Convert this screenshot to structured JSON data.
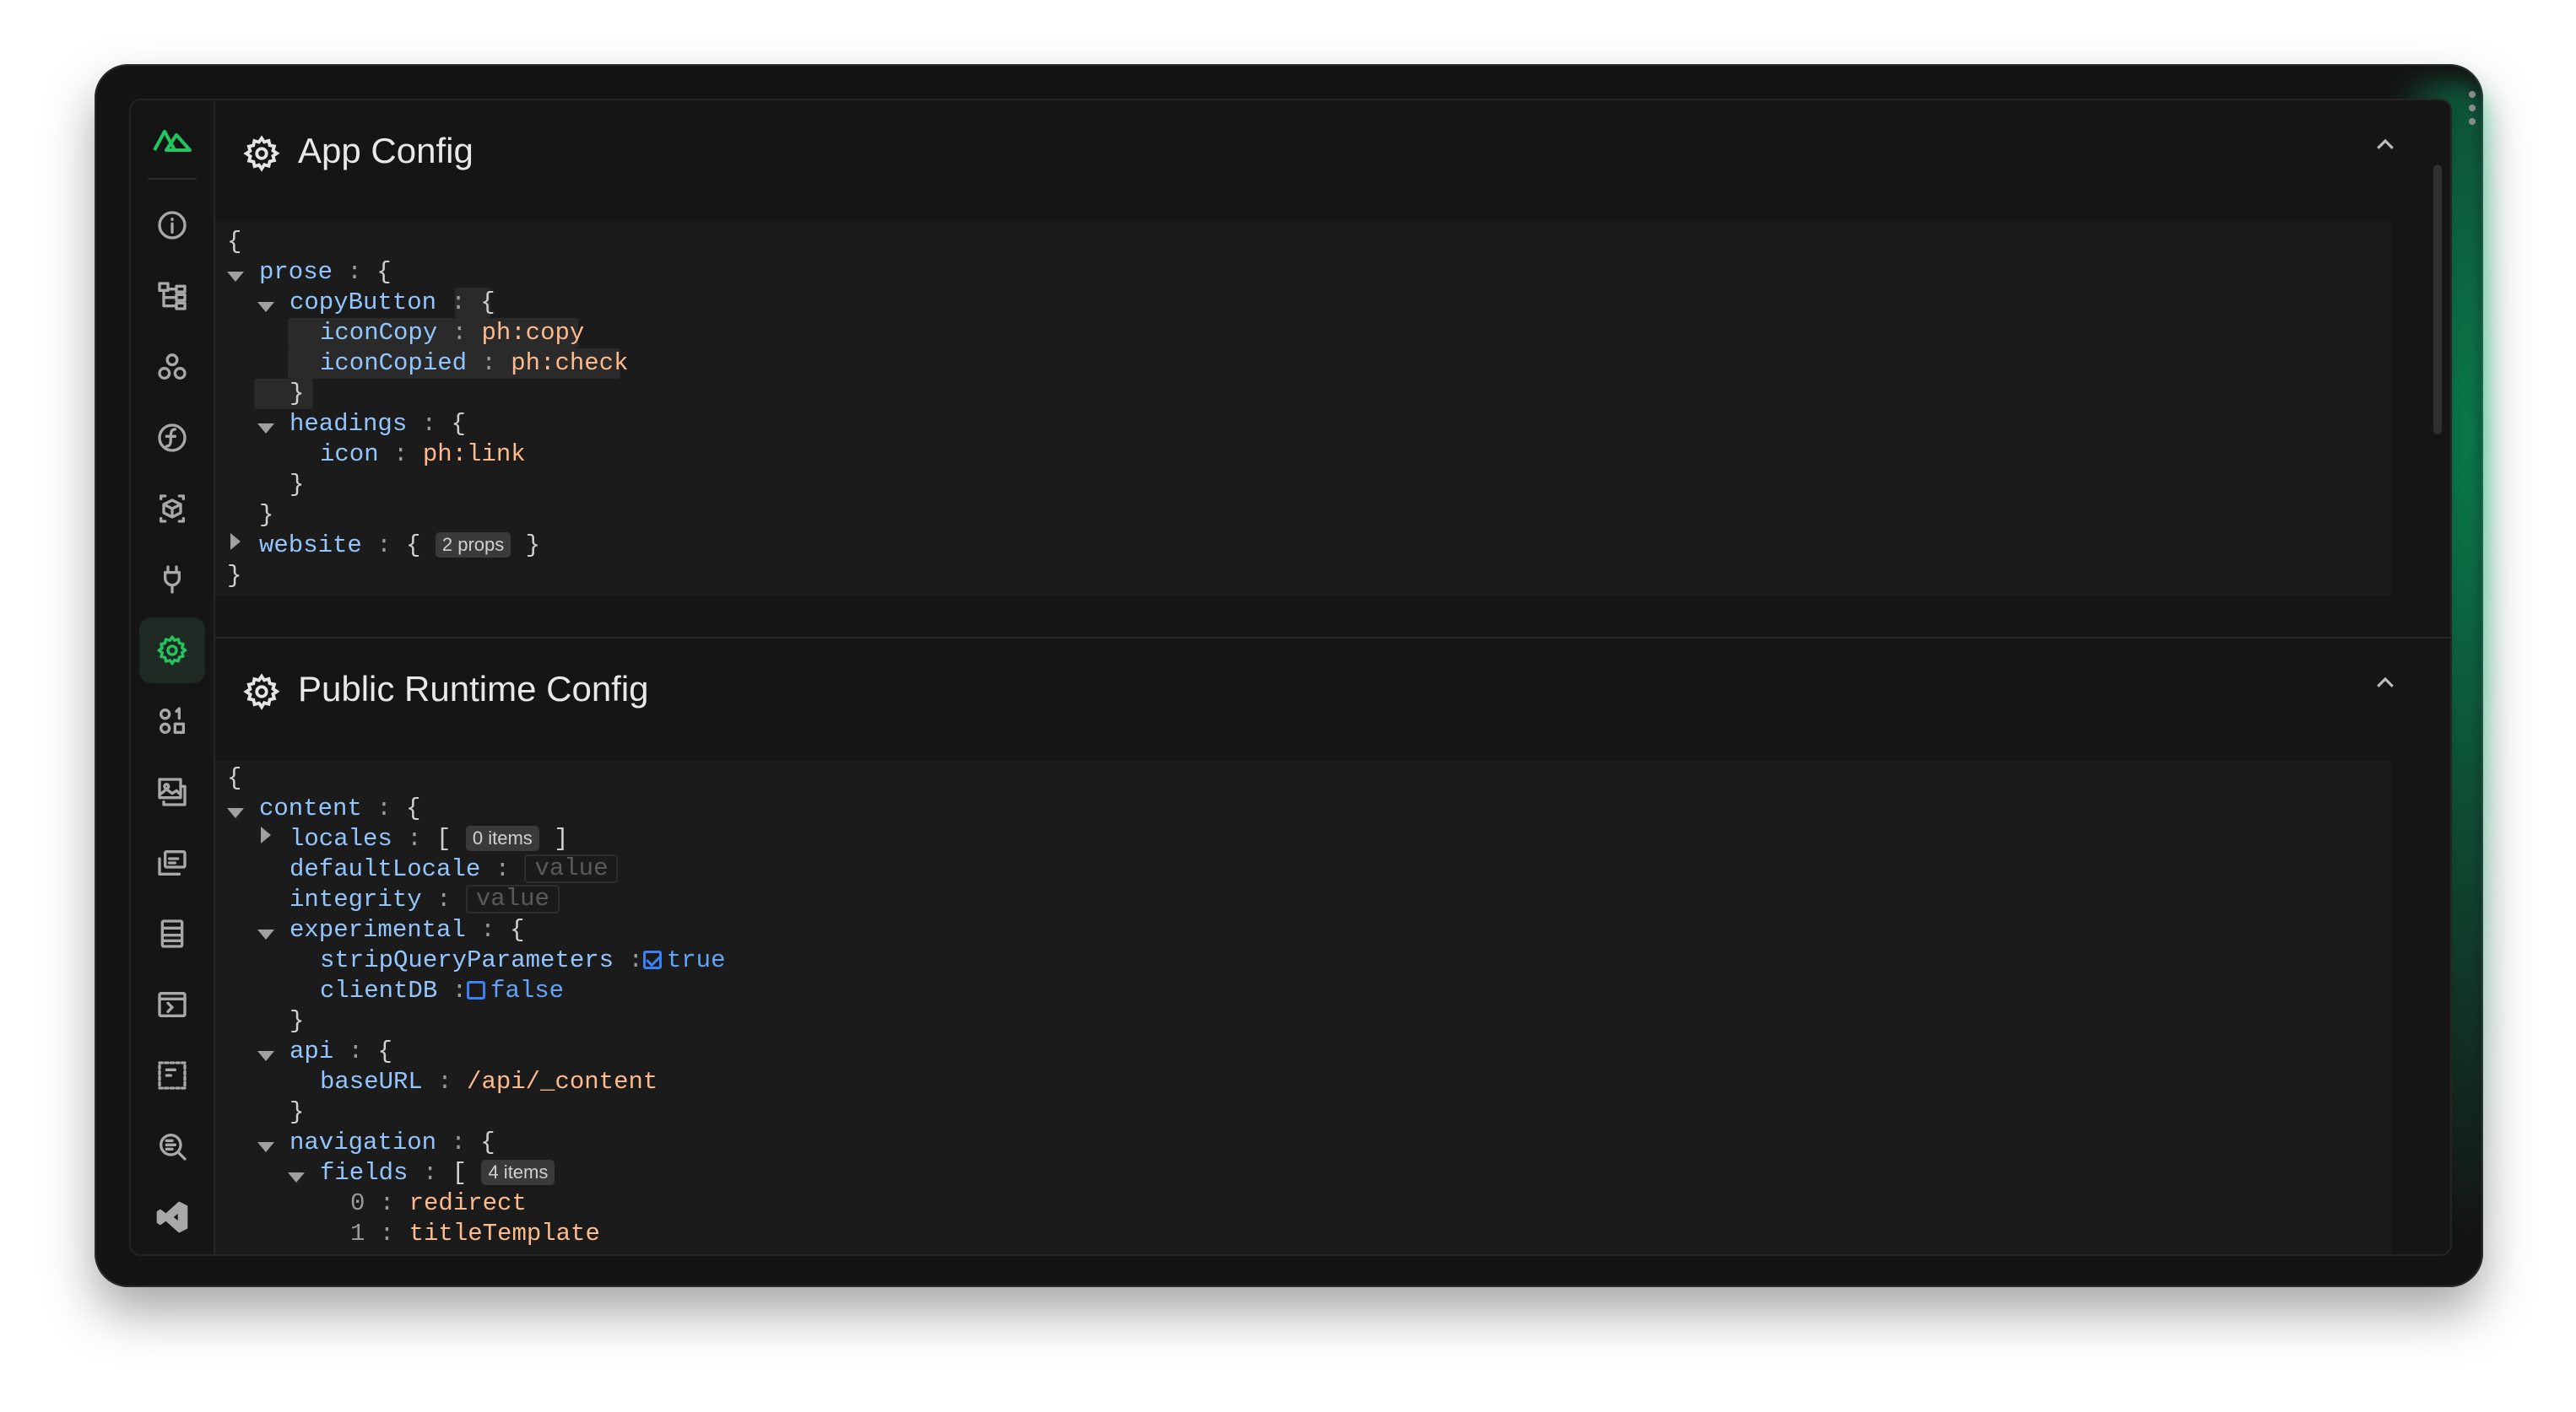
{
  "sidebar": {
    "logo": "nuxt-logo",
    "items": [
      {
        "name": "overview",
        "icon": "info-icon"
      },
      {
        "name": "pages",
        "icon": "tree-icon"
      },
      {
        "name": "components",
        "icon": "components-icon"
      },
      {
        "name": "imports",
        "icon": "function-icon"
      },
      {
        "name": "modules",
        "icon": "cube-icon"
      },
      {
        "name": "plugins",
        "icon": "plug-icon"
      },
      {
        "name": "runtime-config",
        "icon": "gear-icon",
        "active": true
      },
      {
        "name": "payload",
        "icon": "shapes-icon"
      },
      {
        "name": "assets",
        "icon": "images-icon"
      },
      {
        "name": "hooks",
        "icon": "hooks-icon"
      },
      {
        "name": "server-routes",
        "icon": "list-icon"
      },
      {
        "name": "terminals",
        "icon": "terminal-icon"
      },
      {
        "name": "build-analyze",
        "icon": "dashed-icon"
      },
      {
        "name": "inspect",
        "icon": "search-icon"
      },
      {
        "name": "vscode",
        "icon": "vscode-icon"
      }
    ]
  },
  "sections": {
    "app_config": {
      "title": "App Config",
      "lines": {
        "open": "{",
        "prose_key": "prose",
        "copyButton_key": "copyButton",
        "iconCopy_key": "iconCopy",
        "iconCopy_val": "ph:copy",
        "iconCopied_key": "iconCopied",
        "iconCopied_val": "ph:check",
        "headings_key": "headings",
        "icon_key": "icon",
        "icon_val": "ph:link",
        "website_key": "website",
        "website_badge": "2 props",
        "close": "}"
      }
    },
    "public_runtime": {
      "title": "Public Runtime Config",
      "lines": {
        "open": "{",
        "content_key": "content",
        "locales_key": "locales",
        "locales_badge": "0 items",
        "defaultLocale_key": "defaultLocale",
        "defaultLocale_ph": "value",
        "integrity_key": "integrity",
        "integrity_ph": "value",
        "experimental_key": "experimental",
        "stripQuery_key": "stripQueryParameters",
        "stripQuery_val": "true",
        "clientDB_key": "clientDB",
        "clientDB_val": "false",
        "api_key": "api",
        "baseURL_key": "baseURL",
        "baseURL_val": "/api/_content",
        "navigation_key": "navigation",
        "fields_key": "fields",
        "fields_badge": "4 items",
        "f0_idx": "0",
        "f0_val": "redirect",
        "f1_idx": "1",
        "f1_val": "titleTemplate"
      }
    }
  },
  "colors": {
    "accent": "#22c55e",
    "key": "#93c5fd",
    "string": "#fdba8c",
    "boolean": "#60a5fa",
    "background": "#151515"
  }
}
